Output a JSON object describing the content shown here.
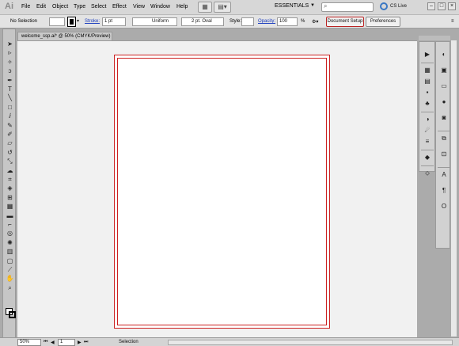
{
  "app": {
    "logo": "Ai"
  },
  "menu": {
    "items": [
      "File",
      "Edit",
      "Object",
      "Type",
      "Select",
      "Effect",
      "View",
      "Window",
      "Help"
    ],
    "workspace": "ESSENTIALS",
    "search_placeholder": "",
    "cs_live": "CS Live"
  },
  "control": {
    "selection": "No Selection",
    "stroke_label": "Stroke:",
    "stroke_value": "1 pt",
    "profile": "Uniform",
    "brush": "2 pt. Oval",
    "style_label": "Style:",
    "opacity_label": "Opacity:",
    "opacity_value": "100",
    "opacity_unit": "%",
    "doc_setup": "Document Setup",
    "preferences": "Preferences"
  },
  "document": {
    "tab_title": "welcome_ssp.ai* @ 50% (CMYK/Preview)"
  },
  "status": {
    "zoom": "50%",
    "artboard": "1",
    "tool": "Selection"
  },
  "tools": [
    "selection-tool-icon",
    "direct-selection-tool-icon",
    "magic-wand-tool-icon",
    "lasso-tool-icon",
    "pen-tool-icon",
    "type-tool-icon",
    "line-tool-icon",
    "rectangle-tool-icon",
    "paintbrush-tool-icon",
    "pencil-tool-icon",
    "blob-brush-tool-icon",
    "eraser-tool-icon",
    "rotate-tool-icon",
    "scale-tool-icon",
    "warp-tool-icon",
    "free-transform-tool-icon",
    "shape-builder-tool-icon",
    "perspective-grid-tool-icon",
    "mesh-tool-icon",
    "gradient-tool-icon",
    "eyedropper-tool-icon",
    "blend-tool-icon",
    "symbol-sprayer-tool-icon",
    "column-graph-tool-icon",
    "artboard-tool-icon",
    "slice-tool-icon",
    "hand-tool-icon",
    "zoom-tool-icon"
  ],
  "dock_left": [
    "navigator-icon",
    "color-guide-icon",
    "swatches-icon",
    "brushes-icon",
    "symbols-icon",
    "graphic-styles-icon",
    "appearance-icon",
    "layers-icon",
    "align-icon",
    "transform-icon"
  ],
  "dock_right": [
    "color-icon",
    "color-swatches-icon",
    "gradient-icon",
    "transparency-icon",
    "stroke-icon",
    "artboards-icon",
    "pathfinder-icon",
    "character-icon",
    "paragraph-icon",
    "opentype-icon"
  ],
  "colors": {
    "artboard_border": "#cc2222",
    "canvas": "#f1f1f1",
    "chrome": "#d7d7d7",
    "cs_live": "#3a78c4"
  }
}
